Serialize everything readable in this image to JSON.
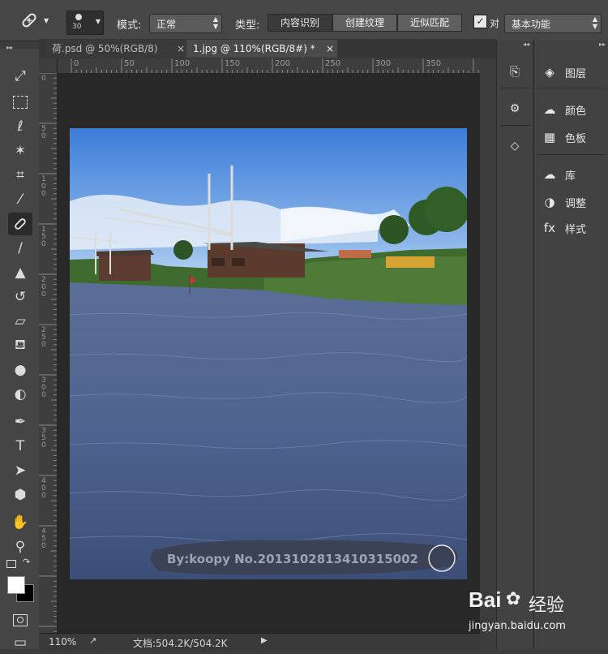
{
  "options_bar": {
    "brush_size": "30",
    "mode_label": "模式:",
    "mode_value": "正常",
    "type_label": "类型:",
    "type_buttons": [
      "内容识别",
      "创建纹理",
      "近似匹配"
    ],
    "sample_all_label": "对",
    "sample_all_checked": true,
    "workspace": "基本功能"
  },
  "doc_tabs": [
    {
      "label": "荷.psd @ 50%(RGB/8)",
      "close": "×",
      "active": false
    },
    {
      "label": "1.jpg @ 110%(RGB/8#) *",
      "close": "×",
      "active": true
    }
  ],
  "rulers": {
    "horizontal": [
      "0",
      "50",
      "100",
      "150",
      "200",
      "250",
      "300",
      "350"
    ],
    "vertical": [
      "0",
      "5 0",
      "1 0 0",
      "1 5 0",
      "2 0 0",
      "2 5 0",
      "3 0 0",
      "3 5 0",
      "4 0 0",
      "4 5 0"
    ]
  },
  "image": {
    "watermark": "By:koopy  No.2013102813410315002"
  },
  "status": {
    "zoom": "110%",
    "doc_info": "文档:504.2K/504.2K"
  },
  "panels": [
    {
      "icon": "layers-icon",
      "label": "图层"
    },
    {
      "icon": "color-icon",
      "label": "颜色"
    },
    {
      "icon": "swatches-icon",
      "label": "色板"
    },
    {
      "icon": "libraries-icon",
      "label": "库"
    },
    {
      "icon": "adjustments-icon",
      "label": "调整"
    },
    {
      "icon": "styles-icon",
      "label": "样式"
    }
  ],
  "baidu": {
    "logo": "Bai",
    "logo_cn": "经验",
    "url": "jingyan.baidu.com"
  }
}
